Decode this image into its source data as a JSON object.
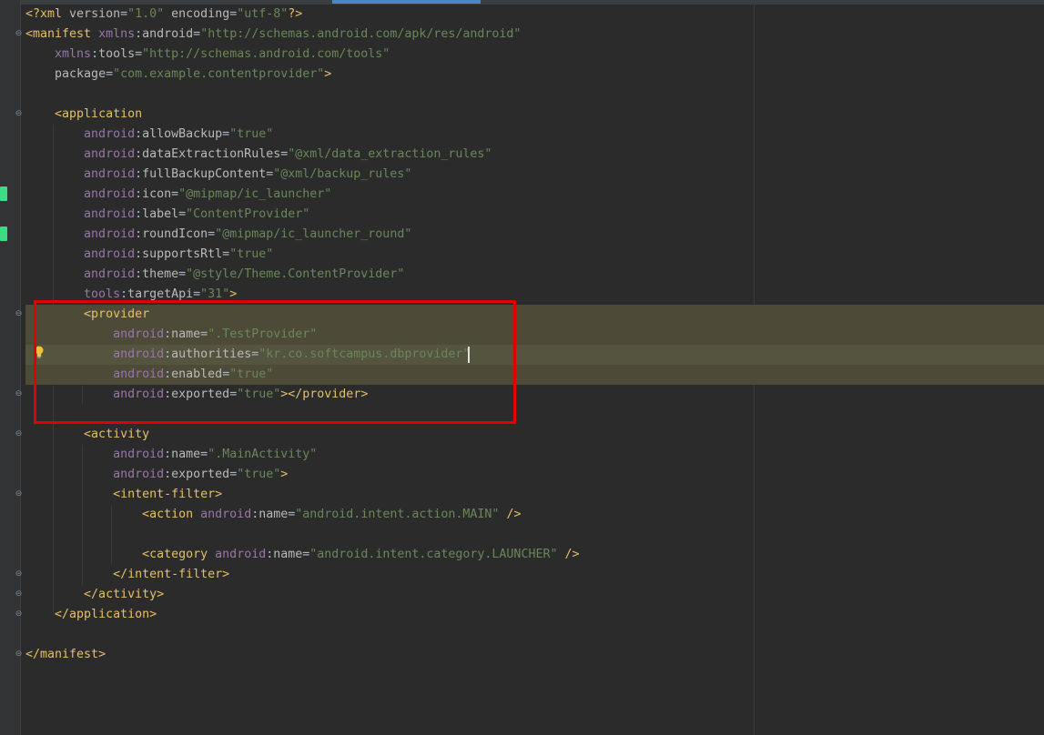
{
  "editor": {
    "file_name": "AndroidManifest.xml",
    "colors": {
      "background": "#2b2b2b",
      "gutter": "#313335",
      "tag": "#e8bf6a",
      "namespace": "#9876aa",
      "attribute": "#bababa",
      "value": "#6a8759",
      "highlight_box": "#e00000",
      "selection": "#4d4b38"
    },
    "lines": [
      "<?xml version=\"1.0\" encoding=\"utf-8\"?>",
      "<manifest xmlns:android=\"http://schemas.android.com/apk/res/android\"",
      "    xmlns:tools=\"http://schemas.android.com/tools\"",
      "    package=\"com.example.contentprovider\">",
      "",
      "    <application",
      "        android:allowBackup=\"true\"",
      "        android:dataExtractionRules=\"@xml/data_extraction_rules\"",
      "        android:fullBackupContent=\"@xml/backup_rules\"",
      "        android:icon=\"@mipmap/ic_launcher\"",
      "        android:label=\"ContentProvider\"",
      "        android:roundIcon=\"@mipmap/ic_launcher_round\"",
      "        android:supportsRtl=\"true\"",
      "        android:theme=\"@style/Theme.ContentProvider\"",
      "        tools:targetApi=\"31\">",
      "        <provider",
      "            android:name=\".TestProvider\"",
      "            android:authorities=\"kr.co.softcampus.dbprovider\"",
      "            android:enabled=\"true\"",
      "            android:exported=\"true\"></provider>",
      "",
      "        <activity",
      "            android:name=\".MainActivity\"",
      "            android:exported=\"true\">",
      "            <intent-filter>",
      "                <action android:name=\"android.intent.action.MAIN\" />",
      "",
      "                <category android:name=\"android.intent.category.LAUNCHER\" />",
      "            </intent-filter>",
      "        </activity>",
      "    </application>",
      "",
      "</manifest>"
    ],
    "gutter_icons": [
      "android-resource-icon",
      "android-resource-icon",
      "lightbulb-icon"
    ]
  }
}
